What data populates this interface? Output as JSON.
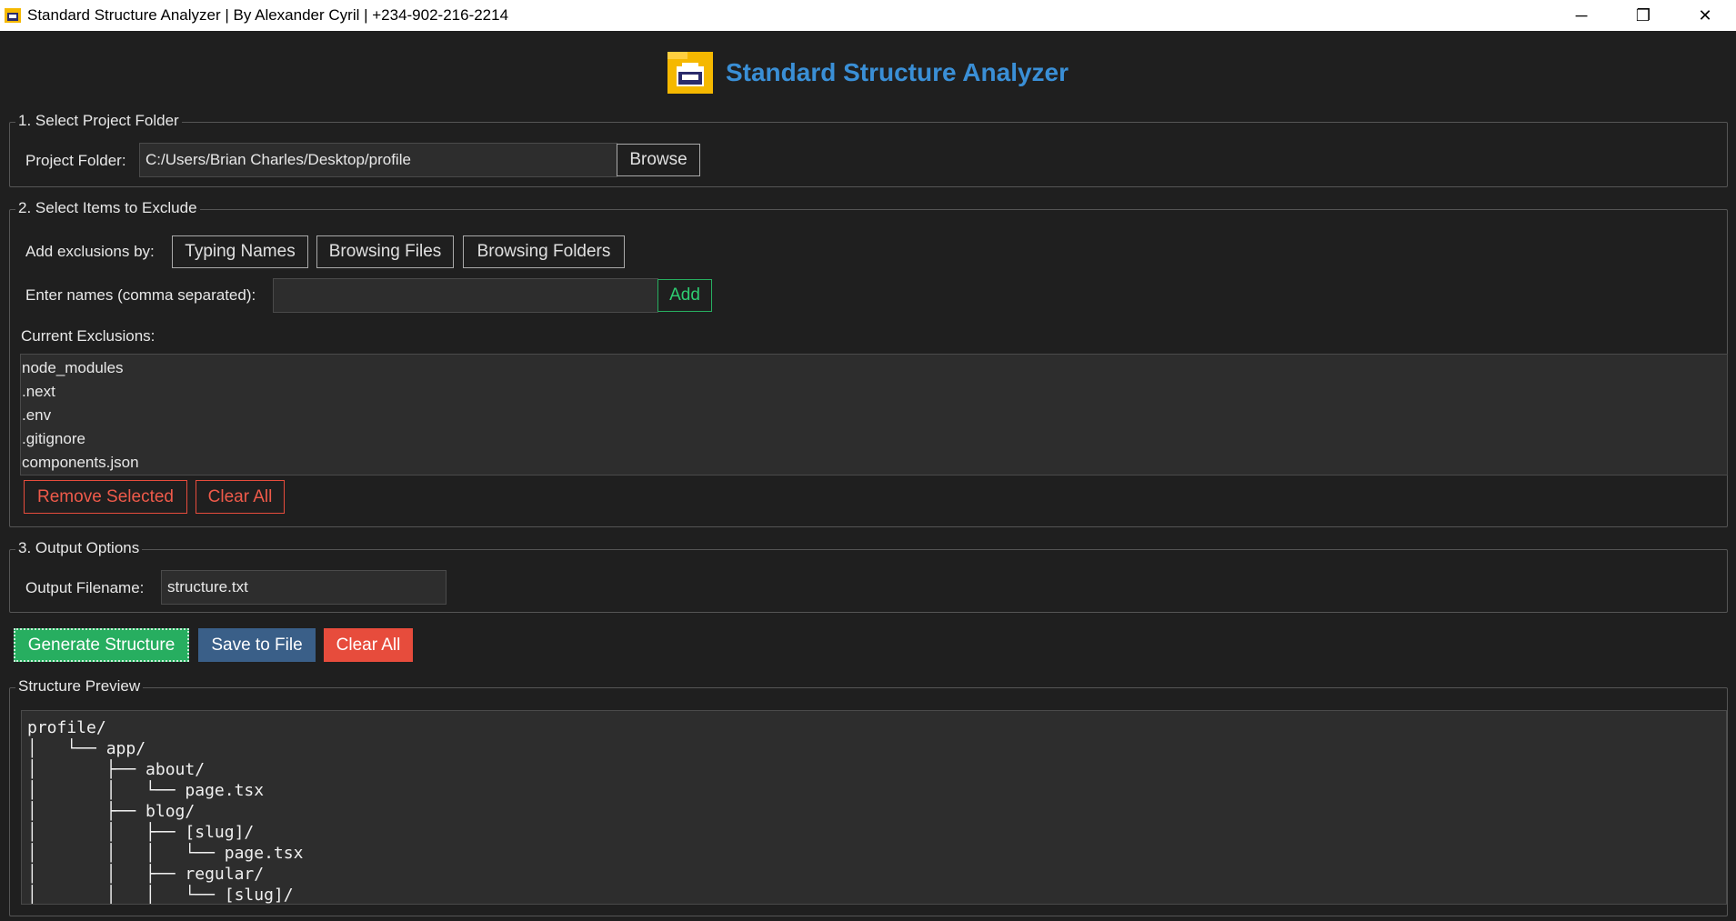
{
  "window": {
    "title": "Standard Structure Analyzer | By Alexander Cyril | +234-902-216-2214",
    "controls": {
      "minimize": "─",
      "restore": "❐",
      "close": "✕"
    }
  },
  "header": {
    "title": "Standard Structure Analyzer"
  },
  "section1": {
    "label": "1. Select Project Folder",
    "folder_label": "Project Folder:",
    "folder_value": "C:/Users/Brian Charles/Desktop/profile",
    "browse_label": "Browse"
  },
  "section2": {
    "label": "2. Select Items to Exclude",
    "add_by_label": "Add exclusions by:",
    "typing_names": "Typing Names",
    "browsing_files": "Browsing Files",
    "browsing_folders": "Browsing Folders",
    "enter_names_label": "Enter names (comma separated):",
    "enter_names_value": "",
    "add_label": "Add",
    "current_label": "Current Exclusions:",
    "exclusions": [
      "node_modules",
      ".next",
      ".env",
      ".gitignore",
      "components.json"
    ],
    "remove_selected": "Remove Selected",
    "clear_all": "Clear All"
  },
  "section3": {
    "label": "3. Output Options",
    "filename_label": "Output Filename:",
    "filename_value": "structure.txt"
  },
  "actions": {
    "generate": "Generate Structure",
    "save": "Save to File",
    "clear_all": "Clear All"
  },
  "preview": {
    "label": "Structure Preview",
    "text": "profile/\n│   └── app/\n│       ├── about/\n│       │   └── page.tsx\n│       ├── blog/\n│       │   ├── [slug]/\n│       │   │   └── page.tsx\n│       │   ├── regular/\n│       │   │   └── [slug]/"
  },
  "colors": {
    "background": "#1f1f1f",
    "title_blue": "#3a8fd6",
    "green": "#27ae60",
    "blue": "#3a5f88",
    "red": "#e74c3c"
  }
}
